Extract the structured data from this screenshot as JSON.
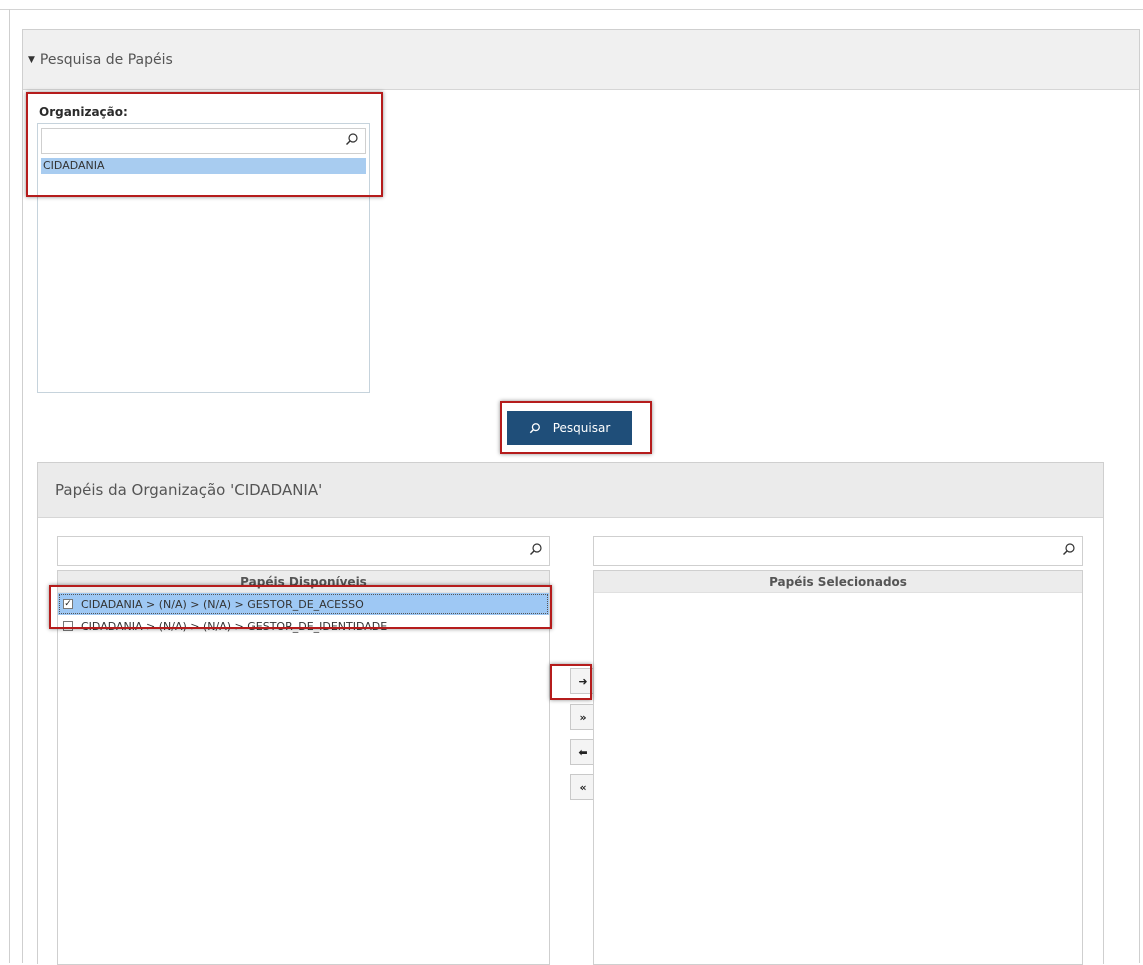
{
  "section": {
    "title": "Pesquisa de Papéis"
  },
  "organization": {
    "label": "Organização:",
    "filter_value": "",
    "items": [
      "CIDADANIA"
    ],
    "selected": "CIDADANIA"
  },
  "search_button": {
    "label": "Pesquisar"
  },
  "roles_panel": {
    "title": "Papéis da Organização 'CIDADANIA'",
    "available": {
      "header": "Papéis Disponíveis",
      "filter_value": "",
      "rows": [
        {
          "label": "CIDADANIA > (N/A) > (N/A) > GESTOR_DE_ACESSO",
          "checked": true
        },
        {
          "label": "CIDADANIA > (N/A) > (N/A) > GESTOR_DE_IDENTIDADE",
          "checked": false
        }
      ]
    },
    "selected": {
      "header": "Papéis Selecionados",
      "filter_value": "",
      "rows": []
    },
    "move_buttons": [
      {
        "name": "move-right",
        "symbol": "➜"
      },
      {
        "name": "move-all-right",
        "symbol": "»"
      },
      {
        "name": "move-left",
        "symbol": "⬅"
      },
      {
        "name": "move-all-left",
        "symbol": "«"
      }
    ]
  },
  "colors": {
    "accent": "#1f4e79",
    "selection": "#a8ccf0",
    "highlight": "#b51c1c"
  }
}
